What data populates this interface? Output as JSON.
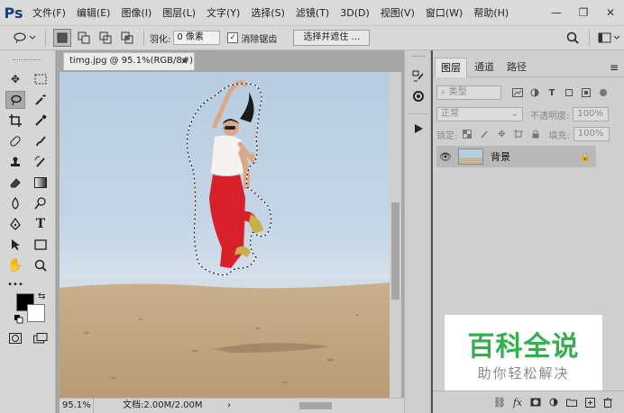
{
  "app": {
    "logo": "Ps"
  },
  "menu": [
    "文件(F)",
    "编辑(E)",
    "图像(I)",
    "图层(L)",
    "文字(Y)",
    "选择(S)",
    "滤镜(T)",
    "3D(D)",
    "视图(V)",
    "窗口(W)",
    "帮助(H)"
  ],
  "window_controls": {
    "minimize": "—",
    "restore": "❐",
    "close": "✕"
  },
  "options": {
    "feather_label": "羽化:",
    "feather_value": "0 像素",
    "antialias_label": "消除锯齿",
    "antialias_checked": "✓",
    "select_mask_label": "选择并遮住 ..."
  },
  "document": {
    "tab_title": "timg.jpg @ 95.1%(RGB/8#)",
    "tab_close": "×",
    "zoom": "95.1%",
    "doc_info": "文档:2.00M/2.00M",
    "status_arrow": "›"
  },
  "layers": {
    "tabs": [
      "图层",
      "通道",
      "路径"
    ],
    "panel_menu": "≡",
    "filter_kind": "类型",
    "blend_mode": "正常",
    "opacity_label": "不透明度:",
    "opacity_value": "100%",
    "lock_label": "锁定:",
    "fill_label": "填充:",
    "fill_value": "100%",
    "rows": [
      {
        "name": "背景",
        "visible_icon": "👁",
        "lock_icon": "🔒"
      }
    ]
  },
  "colors": {
    "foreground": "#000000",
    "background": "#ffffff",
    "accent": "#2fb14c"
  },
  "watermark": {
    "title": "百科全说",
    "subtitle": "助你轻松解决"
  }
}
